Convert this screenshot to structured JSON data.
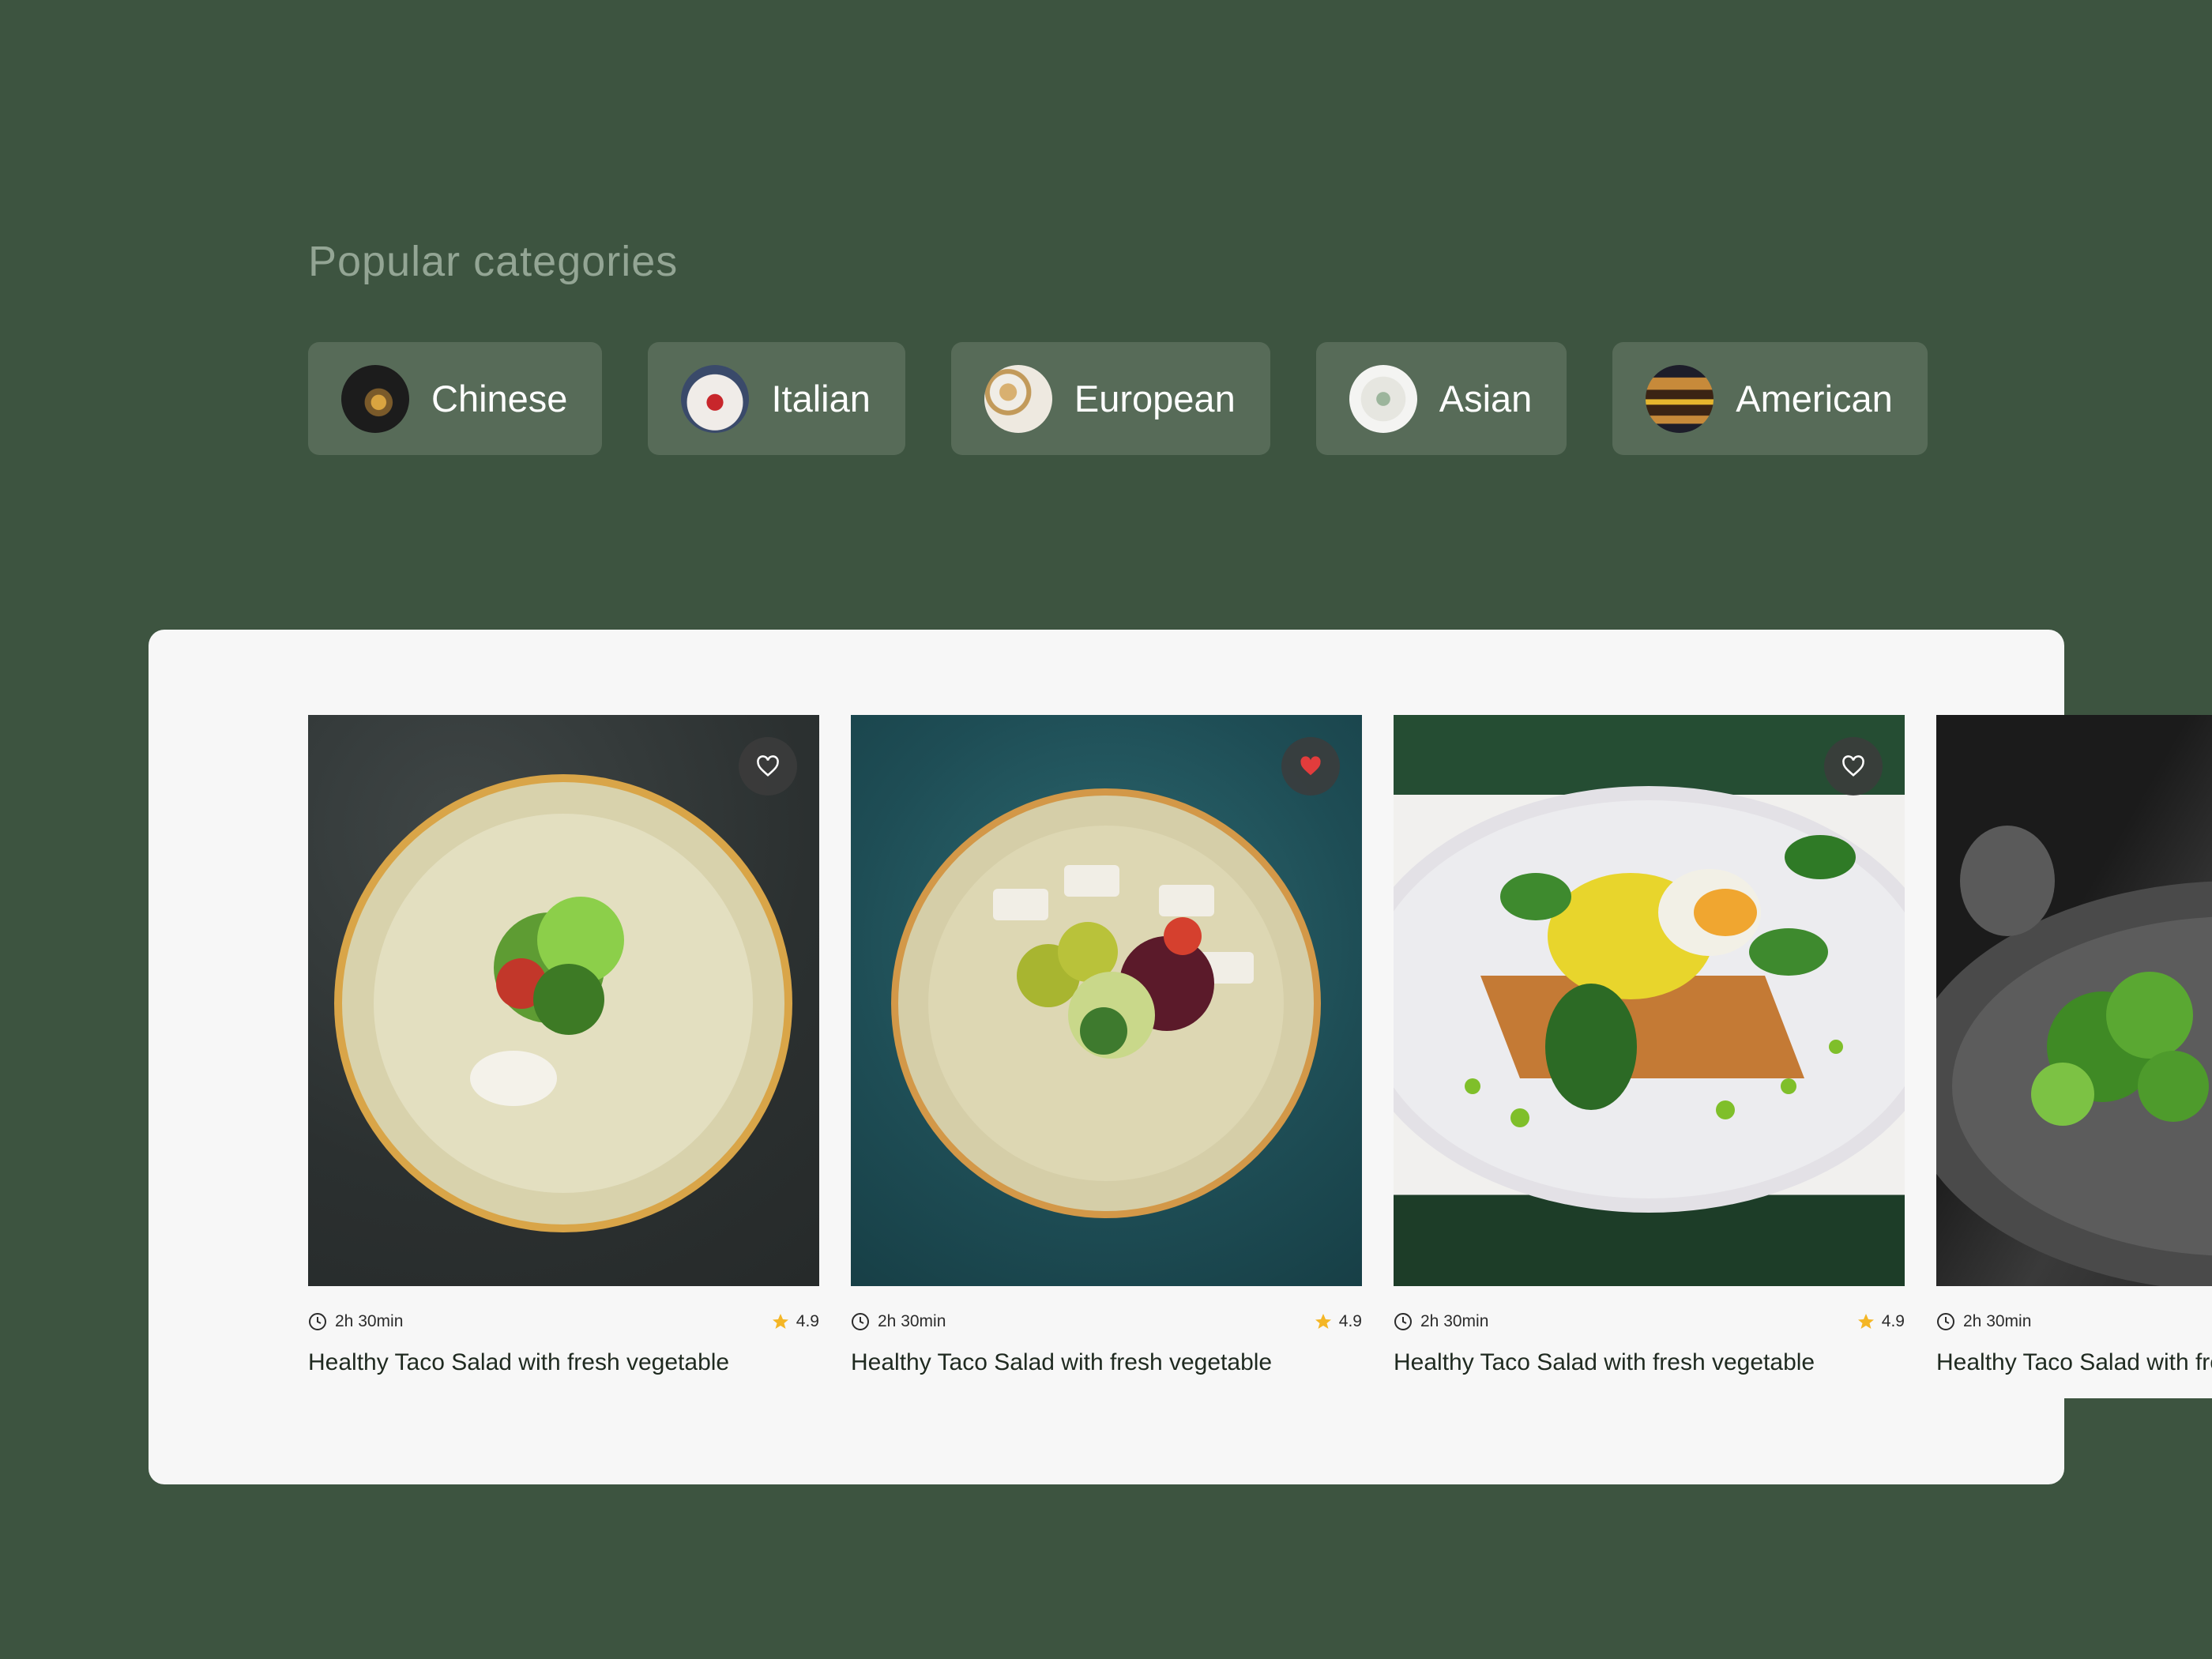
{
  "section": {
    "title": "Popular categories"
  },
  "categories": [
    {
      "label": "Chinese",
      "icon": "chinese-dish-thumbnail"
    },
    {
      "label": "Italian",
      "icon": "italian-dish-thumbnail"
    },
    {
      "label": "European",
      "icon": "european-dish-thumbnail"
    },
    {
      "label": "Asian",
      "icon": "asian-dish-thumbnail"
    },
    {
      "label": "American",
      "icon": "burger-thumbnail"
    }
  ],
  "recipes": [
    {
      "time": "2h 30min",
      "rating": "4.9",
      "title": "Healthy Taco Salad with fresh vegetable",
      "favorited": false
    },
    {
      "time": "2h 30min",
      "rating": "4.9",
      "title": "Healthy Taco Salad with fresh vegetable",
      "favorited": true
    },
    {
      "time": "2h 30min",
      "rating": "4.9",
      "title": "Healthy Taco Salad with fresh vegetable",
      "favorited": false
    },
    {
      "time": "2h 30min",
      "rating": "",
      "title": "Healthy Taco Salad with fresh vegetable",
      "favorited": false
    }
  ],
  "colors": {
    "background": "#3d5440",
    "chip": "#576b58",
    "panel": "#f7f7f7",
    "star": "#f4b626",
    "heart_active": "#e23c3c"
  }
}
